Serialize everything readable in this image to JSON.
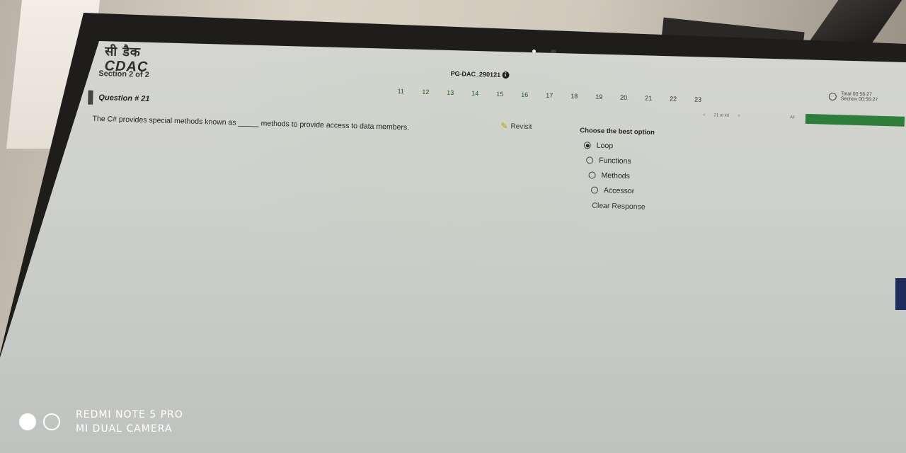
{
  "header": {
    "logo_hindi": "सी डैक",
    "logo_text": "CDAC",
    "section": "Section 2 of 2",
    "exam_code": "PG-DAC_290121",
    "info_icon": "info-icon"
  },
  "question_nav": {
    "numbers": [
      "11",
      "12",
      "13",
      "14",
      "15",
      "16",
      "17",
      "18",
      "19",
      "20",
      "21",
      "22",
      "23"
    ],
    "pager_prev": "<",
    "pager_label": "21 of 40",
    "pager_next": ">",
    "all_label": "All"
  },
  "timer": {
    "total": "Total 00:56:27",
    "section": "Section 00:56:27",
    "icon": "clock-icon"
  },
  "question": {
    "title": "Question # 21",
    "text": "The C# provides special methods known as _____ methods to provide access to data members.",
    "revisit_label": "Revisit",
    "revisit_icon": "edit-check-icon"
  },
  "answers": {
    "prompt": "Choose the best option",
    "options": [
      {
        "label": "Loop",
        "selected": true
      },
      {
        "label": "Functions",
        "selected": false
      },
      {
        "label": "Methods",
        "selected": false
      },
      {
        "label": "Accessor",
        "selected": false
      }
    ],
    "clear_label": "Clear Response"
  },
  "watermark": {
    "line1": "REDMI NOTE 5 PRO",
    "line2": "MI DUAL CAMERA"
  },
  "colors": {
    "answered_green": "#2f7d3a",
    "screen_bg": "#d3d4d0",
    "bezel": "#1e1d1c"
  }
}
